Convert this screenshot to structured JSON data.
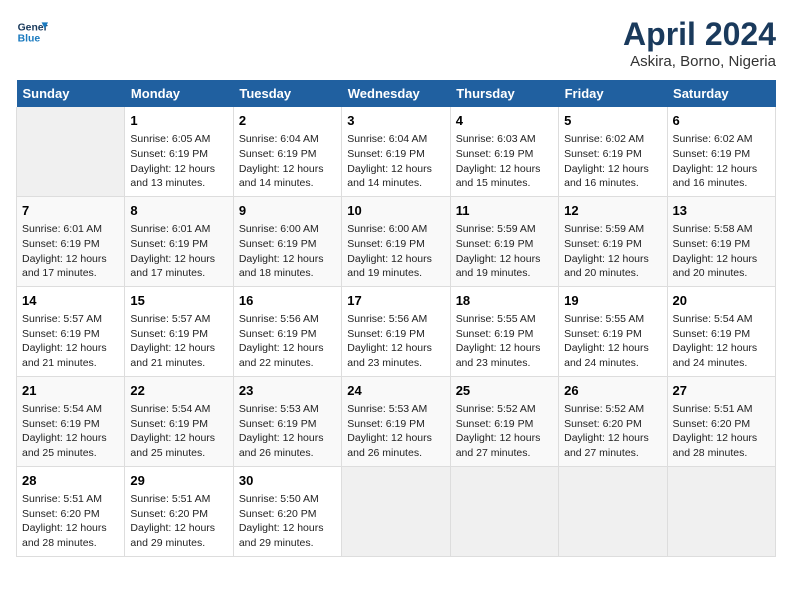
{
  "logo": {
    "line1": "General",
    "line2": "Blue"
  },
  "title": "April 2024",
  "subtitle": "Askira, Borno, Nigeria",
  "days_of_week": [
    "Sunday",
    "Monday",
    "Tuesday",
    "Wednesday",
    "Thursday",
    "Friday",
    "Saturday"
  ],
  "weeks": [
    [
      {
        "day": "",
        "info": ""
      },
      {
        "day": "1",
        "info": "Sunrise: 6:05 AM\nSunset: 6:19 PM\nDaylight: 12 hours\nand 13 minutes."
      },
      {
        "day": "2",
        "info": "Sunrise: 6:04 AM\nSunset: 6:19 PM\nDaylight: 12 hours\nand 14 minutes."
      },
      {
        "day": "3",
        "info": "Sunrise: 6:04 AM\nSunset: 6:19 PM\nDaylight: 12 hours\nand 14 minutes."
      },
      {
        "day": "4",
        "info": "Sunrise: 6:03 AM\nSunset: 6:19 PM\nDaylight: 12 hours\nand 15 minutes."
      },
      {
        "day": "5",
        "info": "Sunrise: 6:02 AM\nSunset: 6:19 PM\nDaylight: 12 hours\nand 16 minutes."
      },
      {
        "day": "6",
        "info": "Sunrise: 6:02 AM\nSunset: 6:19 PM\nDaylight: 12 hours\nand 16 minutes."
      }
    ],
    [
      {
        "day": "7",
        "info": "Sunrise: 6:01 AM\nSunset: 6:19 PM\nDaylight: 12 hours\nand 17 minutes."
      },
      {
        "day": "8",
        "info": "Sunrise: 6:01 AM\nSunset: 6:19 PM\nDaylight: 12 hours\nand 17 minutes."
      },
      {
        "day": "9",
        "info": "Sunrise: 6:00 AM\nSunset: 6:19 PM\nDaylight: 12 hours\nand 18 minutes."
      },
      {
        "day": "10",
        "info": "Sunrise: 6:00 AM\nSunset: 6:19 PM\nDaylight: 12 hours\nand 19 minutes."
      },
      {
        "day": "11",
        "info": "Sunrise: 5:59 AM\nSunset: 6:19 PM\nDaylight: 12 hours\nand 19 minutes."
      },
      {
        "day": "12",
        "info": "Sunrise: 5:59 AM\nSunset: 6:19 PM\nDaylight: 12 hours\nand 20 minutes."
      },
      {
        "day": "13",
        "info": "Sunrise: 5:58 AM\nSunset: 6:19 PM\nDaylight: 12 hours\nand 20 minutes."
      }
    ],
    [
      {
        "day": "14",
        "info": "Sunrise: 5:57 AM\nSunset: 6:19 PM\nDaylight: 12 hours\nand 21 minutes."
      },
      {
        "day": "15",
        "info": "Sunrise: 5:57 AM\nSunset: 6:19 PM\nDaylight: 12 hours\nand 21 minutes."
      },
      {
        "day": "16",
        "info": "Sunrise: 5:56 AM\nSunset: 6:19 PM\nDaylight: 12 hours\nand 22 minutes."
      },
      {
        "day": "17",
        "info": "Sunrise: 5:56 AM\nSunset: 6:19 PM\nDaylight: 12 hours\nand 23 minutes."
      },
      {
        "day": "18",
        "info": "Sunrise: 5:55 AM\nSunset: 6:19 PM\nDaylight: 12 hours\nand 23 minutes."
      },
      {
        "day": "19",
        "info": "Sunrise: 5:55 AM\nSunset: 6:19 PM\nDaylight: 12 hours\nand 24 minutes."
      },
      {
        "day": "20",
        "info": "Sunrise: 5:54 AM\nSunset: 6:19 PM\nDaylight: 12 hours\nand 24 minutes."
      }
    ],
    [
      {
        "day": "21",
        "info": "Sunrise: 5:54 AM\nSunset: 6:19 PM\nDaylight: 12 hours\nand 25 minutes."
      },
      {
        "day": "22",
        "info": "Sunrise: 5:54 AM\nSunset: 6:19 PM\nDaylight: 12 hours\nand 25 minutes."
      },
      {
        "day": "23",
        "info": "Sunrise: 5:53 AM\nSunset: 6:19 PM\nDaylight: 12 hours\nand 26 minutes."
      },
      {
        "day": "24",
        "info": "Sunrise: 5:53 AM\nSunset: 6:19 PM\nDaylight: 12 hours\nand 26 minutes."
      },
      {
        "day": "25",
        "info": "Sunrise: 5:52 AM\nSunset: 6:19 PM\nDaylight: 12 hours\nand 27 minutes."
      },
      {
        "day": "26",
        "info": "Sunrise: 5:52 AM\nSunset: 6:20 PM\nDaylight: 12 hours\nand 27 minutes."
      },
      {
        "day": "27",
        "info": "Sunrise: 5:51 AM\nSunset: 6:20 PM\nDaylight: 12 hours\nand 28 minutes."
      }
    ],
    [
      {
        "day": "28",
        "info": "Sunrise: 5:51 AM\nSunset: 6:20 PM\nDaylight: 12 hours\nand 28 minutes."
      },
      {
        "day": "29",
        "info": "Sunrise: 5:51 AM\nSunset: 6:20 PM\nDaylight: 12 hours\nand 29 minutes."
      },
      {
        "day": "30",
        "info": "Sunrise: 5:50 AM\nSunset: 6:20 PM\nDaylight: 12 hours\nand 29 minutes."
      },
      {
        "day": "",
        "info": ""
      },
      {
        "day": "",
        "info": ""
      },
      {
        "day": "",
        "info": ""
      },
      {
        "day": "",
        "info": ""
      }
    ]
  ]
}
